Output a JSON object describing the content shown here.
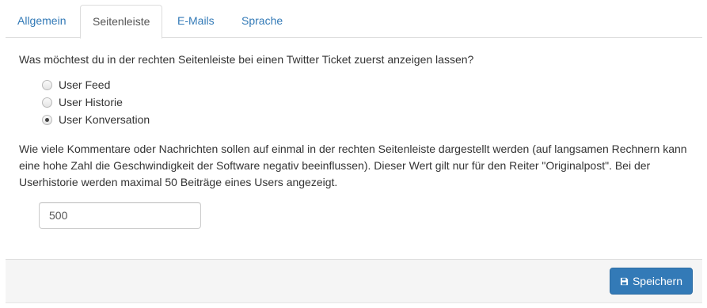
{
  "tabs": [
    {
      "label": "Allgemein",
      "active": false
    },
    {
      "label": "Seitenleiste",
      "active": true
    },
    {
      "label": "E-Mails",
      "active": false
    },
    {
      "label": "Sprache",
      "active": false
    }
  ],
  "question": "Was möchtest du in der rechten Seitenleiste bei einen Twitter Ticket zuerst anzeigen lassen?",
  "options": [
    {
      "label": "User Feed",
      "checked": false
    },
    {
      "label": "User Historie",
      "checked": false
    },
    {
      "label": "User Konversation",
      "checked": true
    }
  ],
  "description": "Wie viele Kommentare oder Nachrichten sollen auf einmal in der rechten Seitenleiste dargestellt werden (auf langsamen Rechnern kann eine hohe Zahl die Geschwindigkeit der Software negativ beeinflussen). Dieser Wert gilt nur für den Reiter \"Originalpost\". Bei der Userhistorie werden maximal 50 Beiträge eines Users angezeigt.",
  "count_input": {
    "value": "500"
  },
  "footer": {
    "save_label": "Speichern",
    "save_icon": "floppy-disk-icon"
  },
  "colors": {
    "primary": "#337ab7",
    "link": "#337ab7",
    "footer_bg": "#f5f5f5"
  }
}
